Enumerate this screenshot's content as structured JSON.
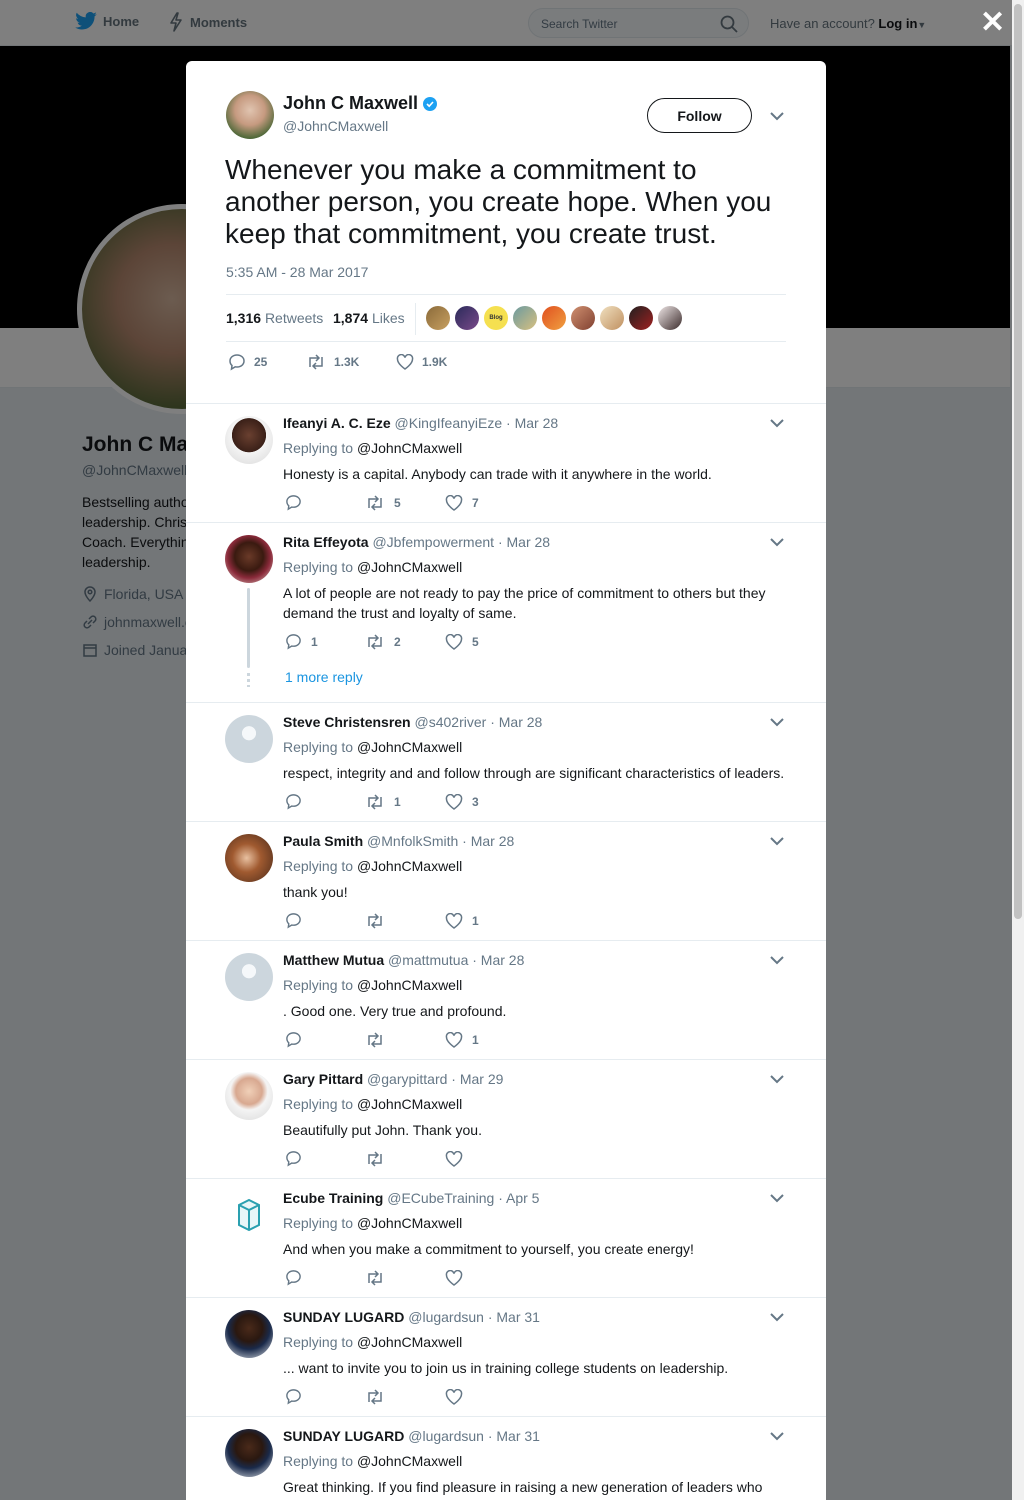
{
  "topbar": {
    "home_label": "Home",
    "moments_label": "Moments",
    "search_placeholder": "Search Twitter",
    "account_prompt": "Have an account?",
    "login_label": "Log in"
  },
  "profile": {
    "name": "John C Ma",
    "handle": "@JohnCMaxwell",
    "bio": "Bestselling autho\nleadership. Chris\nCoach. Everythin\nleadership.",
    "location": "Florida, USA",
    "website": "johnmaxwell.c",
    "joined": "Joined Janua"
  },
  "tweet": {
    "name": "John C Maxwell",
    "handle": "@JohnCMaxwell",
    "follow_label": "Follow",
    "text": "Whenever you make a commitment to another person, you create hope. When you keep that commitment, you create trust.",
    "timestamp": "5:35 AM - 28 Mar 2017",
    "retweets_count": "1,316",
    "retweets_label": "Retweets",
    "likes_count": "1,874",
    "likes_label": "Likes",
    "liker_badge": "Blog",
    "reply_count": "25",
    "retweet_count_short": "1.3K",
    "like_count_short": "1.9K"
  },
  "replies": [
    {
      "name": "Ifeanyi A. C. Eze",
      "handle": "@KingIfeanyiEze",
      "date": "· Mar 28",
      "replying_prefix": "Replying to",
      "replying_to": "@JohnCMaxwell",
      "text": "Honesty is a capital. Anybody can trade with it anywhere in the world.",
      "replies": "",
      "retweets": "5",
      "likes": "7"
    },
    {
      "name": "Rita Effeyota",
      "handle": "@Jbfempowerment",
      "date": "· Mar 28",
      "replying_prefix": "Replying to",
      "replying_to": "@JohnCMaxwell",
      "text": "A lot of people are not ready to pay the price of commitment to others but they demand the trust and loyalty of same.",
      "replies": "1",
      "retweets": "2",
      "likes": "5",
      "more_replies": "1 more reply"
    },
    {
      "name": "Steve Christensren",
      "handle": "@s402river",
      "date": "· Mar 28",
      "replying_prefix": "Replying to",
      "replying_to": "@JohnCMaxwell",
      "text": "respect, integrity and and follow through are significant characteristics of leaders.",
      "replies": "",
      "retweets": "1",
      "likes": "3"
    },
    {
      "name": "Paula Smith",
      "handle": "@MnfolkSmith",
      "date": "· Mar 28",
      "replying_prefix": "Replying to",
      "replying_to": "@JohnCMaxwell",
      "text": "thank you!",
      "replies": "",
      "retweets": "",
      "likes": "1"
    },
    {
      "name": "Matthew Mutua",
      "handle": "@mattmutua",
      "date": "· Mar 28",
      "replying_prefix": "Replying to",
      "replying_to": "@JohnCMaxwell",
      "text": ". Good one. Very true and profound.",
      "replies": "",
      "retweets": "",
      "likes": "1"
    },
    {
      "name": "Gary Pittard",
      "handle": "@garypittard",
      "date": "· Mar 29",
      "replying_prefix": "Replying to",
      "replying_to": "@JohnCMaxwell",
      "text": "Beautifully put John. Thank you.",
      "replies": "",
      "retweets": "",
      "likes": ""
    },
    {
      "name": "Ecube Training",
      "handle": "@ECubeTraining",
      "date": "· Apr 5",
      "replying_prefix": "Replying to",
      "replying_to": "@JohnCMaxwell",
      "text": "And when you make a commitment to yourself, you create energy!",
      "replies": "",
      "retweets": "",
      "likes": ""
    },
    {
      "name": "SUNDAY LUGARD",
      "handle": "@lugardsun",
      "date": "· Mar 31",
      "replying_prefix": "Replying to",
      "replying_to": "@JohnCMaxwell",
      "text": "... want to invite you to join us in training college students on leadership.",
      "replies": "",
      "retweets": "",
      "likes": ""
    },
    {
      "name": "SUNDAY LUGARD",
      "handle": "@lugardsun",
      "date": "· Mar 31",
      "replying_prefix": "Replying to",
      "replying_to": "@JohnCMaxwell",
      "text": "Great thinking. If you find pleasure in raising a new generation of leaders who",
      "replies": "",
      "retweets": "",
      "likes": ""
    }
  ],
  "colors": {
    "twitter_blue": "#1da1f2",
    "link_blue": "#1b95e0",
    "text_gray": "#657786"
  }
}
